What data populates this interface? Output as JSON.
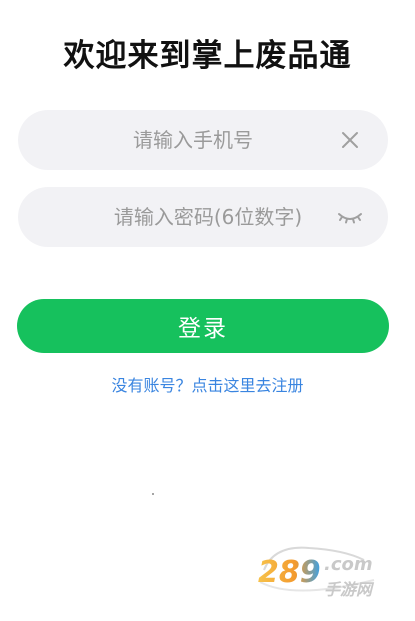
{
  "page": {
    "title": "欢迎来到掌上废品通"
  },
  "phone": {
    "placeholder": "请输入手机号",
    "value": "",
    "clear_icon": "close-icon"
  },
  "password": {
    "placeholder": "请输入密码(6位数字)",
    "value": "",
    "toggle_icon": "eye-closed-icon"
  },
  "login": {
    "label": "登录"
  },
  "register": {
    "label": "没有账号？点击这里去注册"
  },
  "watermark": {
    "logo_text": "289.com",
    "sub_text": "手游网"
  },
  "colors": {
    "primary": "#16c15d",
    "link": "#3a85e0",
    "field_bg": "#f2f2f5",
    "placeholder": "#9a9a9a",
    "title": "#111111"
  }
}
